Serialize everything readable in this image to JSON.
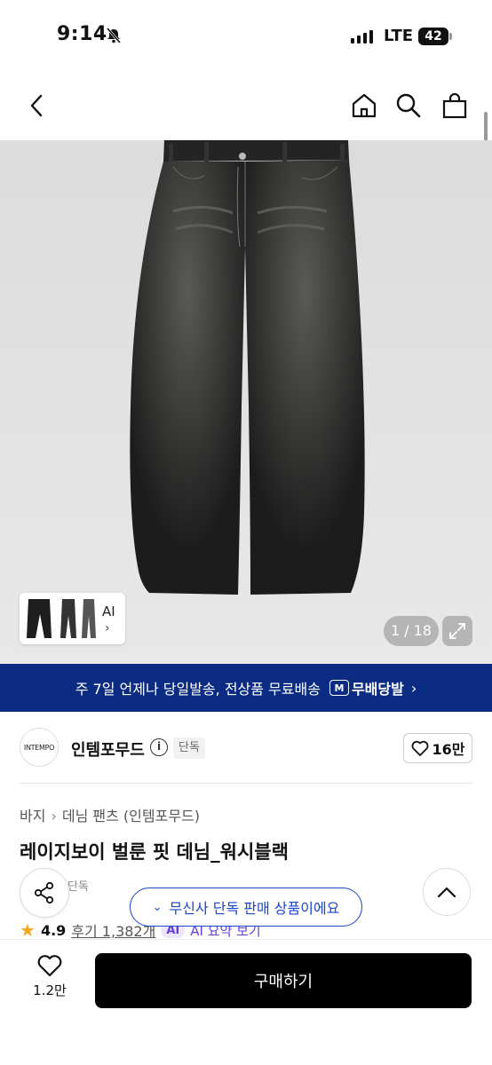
{
  "status_bar": {
    "time": "9:14",
    "network": "LTE",
    "battery": "42"
  },
  "nav": {
    "back_icon": "chevron-left-icon",
    "home_icon": "home-icon",
    "search_icon": "search-icon",
    "cart_icon": "shopping-bag-icon"
  },
  "gallery": {
    "thumb_label": "AI",
    "pager": "1 / 18"
  },
  "shipping_banner": {
    "text": "주 7일 언제나 당일발송, 전상품 무료배송",
    "badge": "M",
    "badge_label": "무배당발",
    "accent_color": "#0b2c82"
  },
  "brand": {
    "logo_text": "INTEMPO",
    "name": "인템포무드",
    "tag": "단독",
    "likes": "16만"
  },
  "product": {
    "breadcrumb": [
      "바지",
      "데님 팬츠 (인템포무드)"
    ],
    "title": "레이지보이 벌룬 핏 데님_워시블랙",
    "sub_tag": "단독",
    "rating": "4.9",
    "reviews": "후기 1,382개",
    "ai_badge": "AI",
    "ai_summary": "AI 요약 보기"
  },
  "toast": {
    "text": "무신사 단독 판매 상품이에요"
  },
  "bottom_bar": {
    "like_count": "1.2만",
    "buy_label": "구매하기"
  }
}
